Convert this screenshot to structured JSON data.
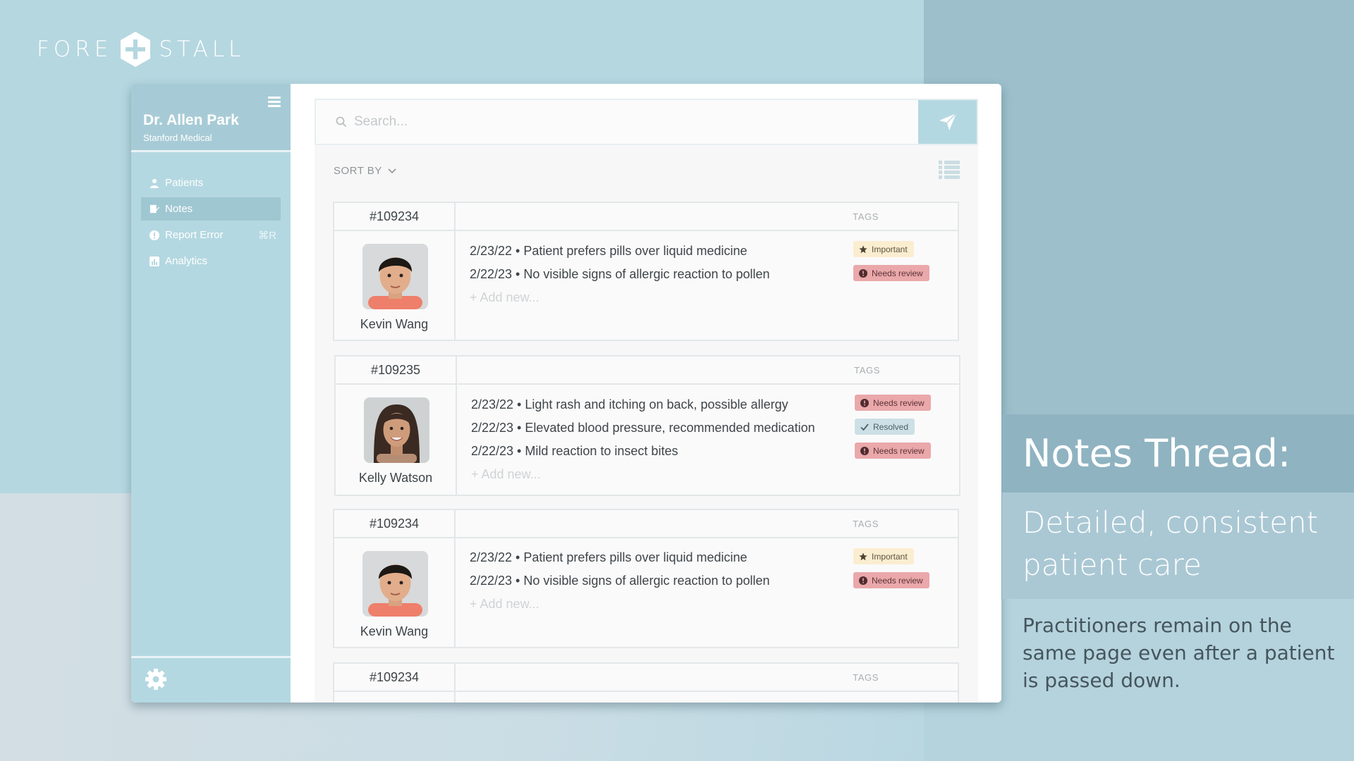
{
  "brand": {
    "left": "FORE",
    "right": "STALL"
  },
  "user": {
    "name": "Dr. Allen Park",
    "org": "Stanford Medical"
  },
  "nav": [
    {
      "label": "Patients",
      "icon": "person-icon"
    },
    {
      "label": "Notes",
      "icon": "notes-icon",
      "active": true
    },
    {
      "label": "Report Error",
      "icon": "alert-icon",
      "shortcut": "⌘R"
    },
    {
      "label": "Analytics",
      "icon": "chart-icon"
    }
  ],
  "search": {
    "placeholder": "Search..."
  },
  "toolbar": {
    "sort_label": "SORT BY"
  },
  "tags_header": "TAGS",
  "add_new": "+ Add new...",
  "cards": [
    {
      "id": "#109234",
      "patient": "Kevin Wang",
      "notes": [
        "2/23/22 • Patient prefers pills over liquid medicine",
        "2/22/23 • No visible signs of allergic reaction to pollen"
      ],
      "tags": [
        "Important",
        "Needs review"
      ]
    },
    {
      "id": "#109235",
      "patient": "Kelly Watson",
      "notes": [
        "2/23/22 • Light rash and itching on back, possible allergy",
        "2/22/23 • Elevated blood pressure, recommended medication",
        "2/22/23 • Mild reaction to insect bites"
      ],
      "tags": [
        "Needs review",
        "Resolved",
        "Needs review"
      ]
    },
    {
      "id": "#109234",
      "patient": "Kevin Wang",
      "notes": [
        "2/23/22 • Patient prefers pills over liquid medicine",
        "2/22/23 • No visible signs of allergic reaction to pollen"
      ],
      "tags": [
        "Important",
        "Needs review"
      ]
    },
    {
      "id": "#109234"
    }
  ],
  "panel": {
    "title": "Notes Thread:",
    "subtitle": "Detailed, consistent patient care",
    "body": "Practitioners remain on the same page even after a patient is passed down."
  },
  "colors": {
    "accent": "#b4d8e1",
    "important": "#fbedd0",
    "needs_review": "#eaa8ab",
    "resolved": "#cde0e6"
  }
}
